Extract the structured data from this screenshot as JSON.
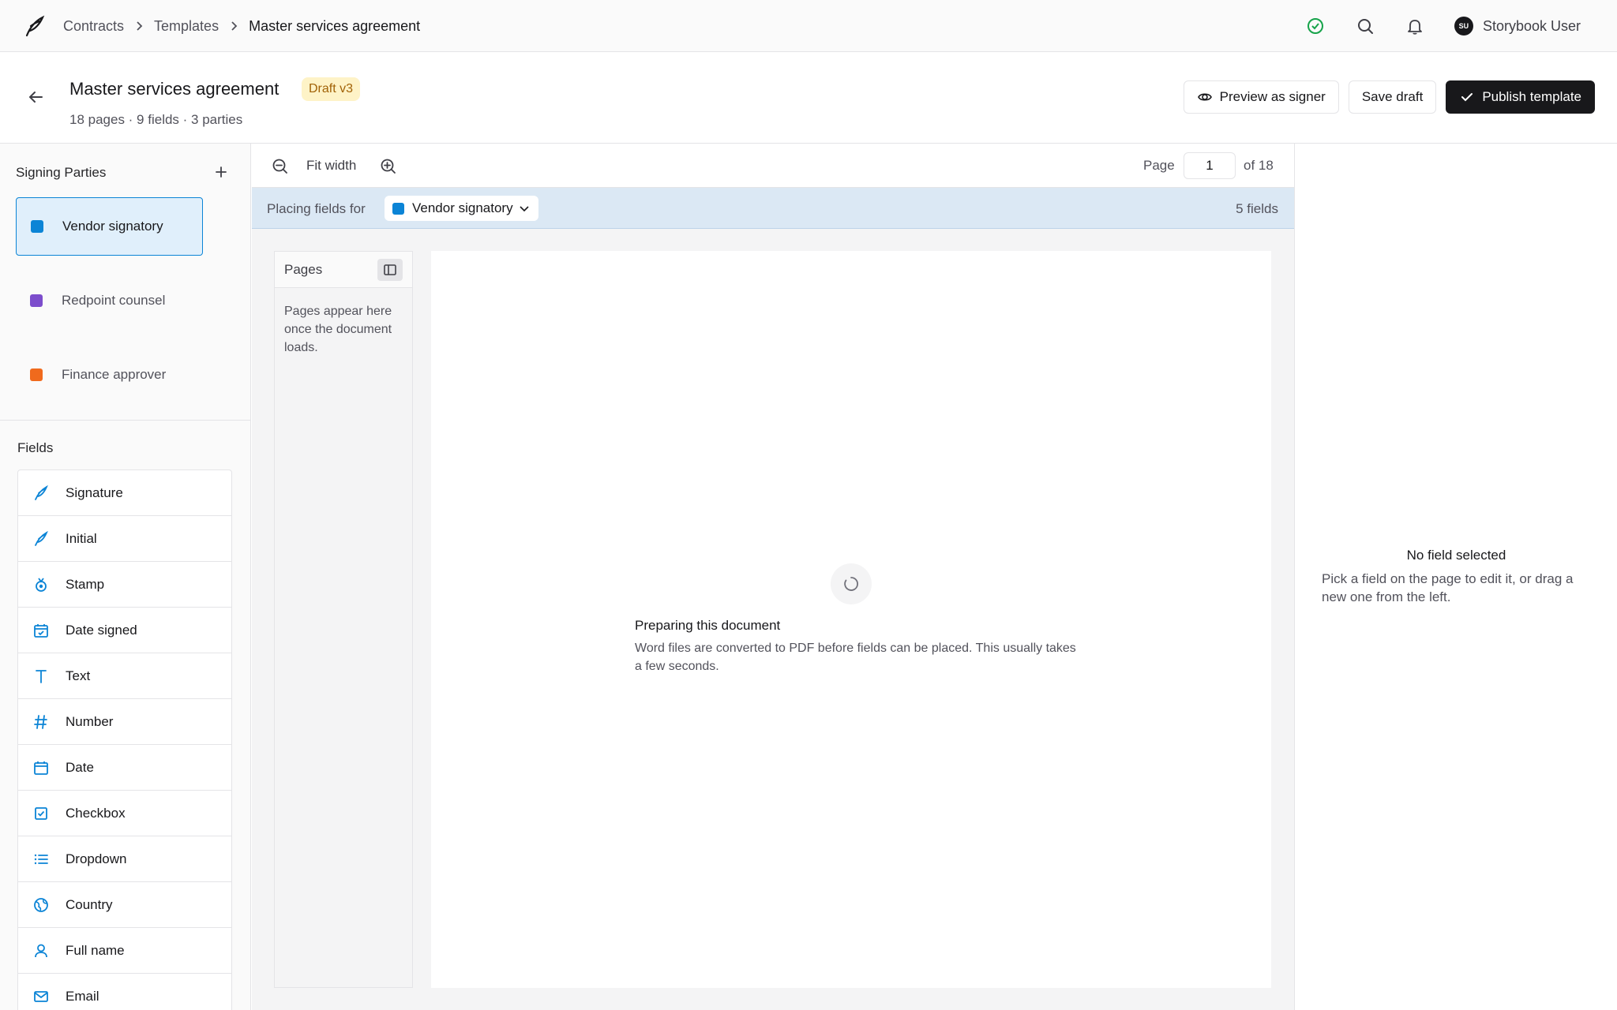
{
  "nav": {
    "breadcrumbs": [
      "Contracts",
      "Templates",
      "Master services agreement"
    ],
    "user_name": "Storybook User",
    "user_initials": "SU"
  },
  "header": {
    "title": "Master services agreement",
    "badge": "Draft v3",
    "subtitle": "18 pages · 9 fields · 3 parties",
    "preview_label": "Preview as signer",
    "save_label": "Save draft",
    "publish_label": "Publish template"
  },
  "sidebar": {
    "parties_title": "Signing Parties",
    "parties": [
      {
        "label": "Vendor signatory",
        "color": "#0b84d6"
      },
      {
        "label": "Redpoint counsel",
        "color": "#7c4dcc"
      },
      {
        "label": "Finance approver",
        "color": "#f06a1d"
      }
    ],
    "fields_title": "Fields",
    "fields": [
      {
        "label": "Signature",
        "icon": "pen-nib-icon"
      },
      {
        "label": "Initial",
        "icon": "pen-nib-icon"
      },
      {
        "label": "Stamp",
        "icon": "stamp-icon"
      },
      {
        "label": "Date signed",
        "icon": "calendar-check-icon"
      },
      {
        "label": "Text",
        "icon": "text-icon"
      },
      {
        "label": "Number",
        "icon": "hash-icon"
      },
      {
        "label": "Date",
        "icon": "calendar-icon"
      },
      {
        "label": "Checkbox",
        "icon": "checkbox-icon"
      },
      {
        "label": "Dropdown",
        "icon": "list-icon"
      },
      {
        "label": "Country",
        "icon": "globe-icon"
      },
      {
        "label": "Full name",
        "icon": "user-icon"
      },
      {
        "label": "Email",
        "icon": "mail-icon"
      }
    ]
  },
  "toolbar": {
    "fit_width": "Fit width",
    "page_label": "Page",
    "page_value": "1",
    "page_of": "of 18"
  },
  "placing": {
    "label": "Placing fields for",
    "party": "Vendor signatory",
    "party_color": "#0b84d6",
    "count": "5 fields"
  },
  "pages_panel": {
    "title": "Pages",
    "empty_text": "Pages appear here once the document loads."
  },
  "canvas": {
    "title": "Preparing this document",
    "body": "Word files are converted to PDF before fields can be placed. This usually takes a few seconds."
  },
  "right_panel": {
    "title": "No field selected",
    "body": "Pick a field on the page to edit it, or drag a new one from the left."
  },
  "colors": {
    "accent": "#0b84d6",
    "success": "#16a34a",
    "badge_bg": "#fef3c7",
    "badge_text": "#a16207"
  }
}
